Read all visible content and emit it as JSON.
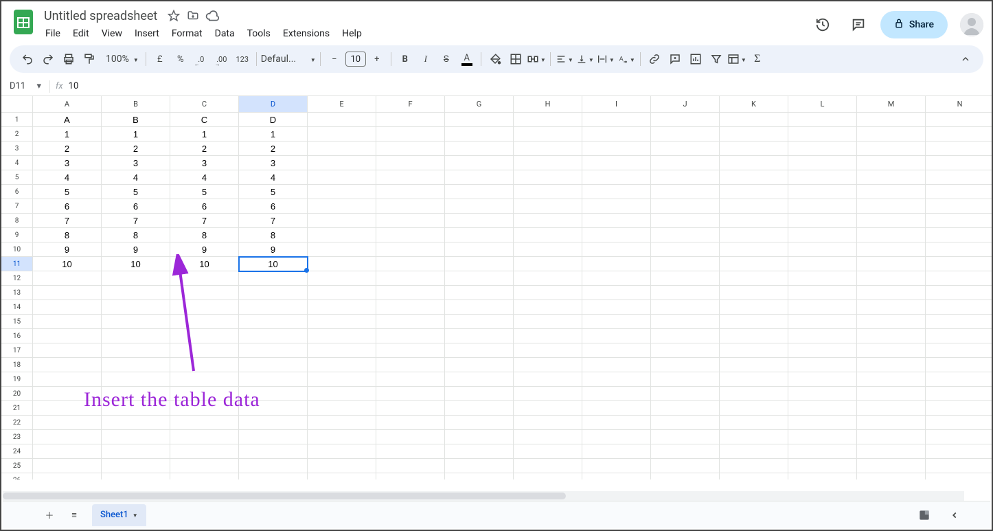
{
  "header": {
    "title": "Untitled spreadsheet",
    "menu": [
      "File",
      "Edit",
      "View",
      "Insert",
      "Format",
      "Data",
      "Tools",
      "Extensions",
      "Help"
    ],
    "share_label": "Share"
  },
  "toolbar": {
    "zoom": "100%",
    "currency": "£",
    "percent": "%",
    "dec_dec": ".0",
    "dec_inc": ".00",
    "num123": "123",
    "font": "Defaul...",
    "font_size": "10",
    "text_color_bar": "#000000",
    "fill_color": "transparent"
  },
  "formula_bar": {
    "cell_ref": "D11",
    "value": "10"
  },
  "grid": {
    "columns": [
      "A",
      "B",
      "C",
      "D",
      "E",
      "F",
      "G",
      "H",
      "I",
      "J",
      "K",
      "L",
      "M",
      "N"
    ],
    "num_rows": 26,
    "selected": {
      "row": 11,
      "col": 4
    },
    "data": [
      [
        "A",
        "B",
        "C",
        "D"
      ],
      [
        "1",
        "1",
        "1",
        "1"
      ],
      [
        "2",
        "2",
        "2",
        "2"
      ],
      [
        "3",
        "3",
        "3",
        "3"
      ],
      [
        "4",
        "4",
        "4",
        "4"
      ],
      [
        "5",
        "5",
        "5",
        "5"
      ],
      [
        "6",
        "6",
        "6",
        "6"
      ],
      [
        "7",
        "7",
        "7",
        "7"
      ],
      [
        "8",
        "8",
        "8",
        "8"
      ],
      [
        "9",
        "9",
        "9",
        "9"
      ],
      [
        "10",
        "10",
        "10",
        "10"
      ]
    ]
  },
  "sheet_bar": {
    "active_tab": "Sheet1"
  },
  "annotation": {
    "text": "Insert the table data",
    "color": "#9c27d8"
  }
}
